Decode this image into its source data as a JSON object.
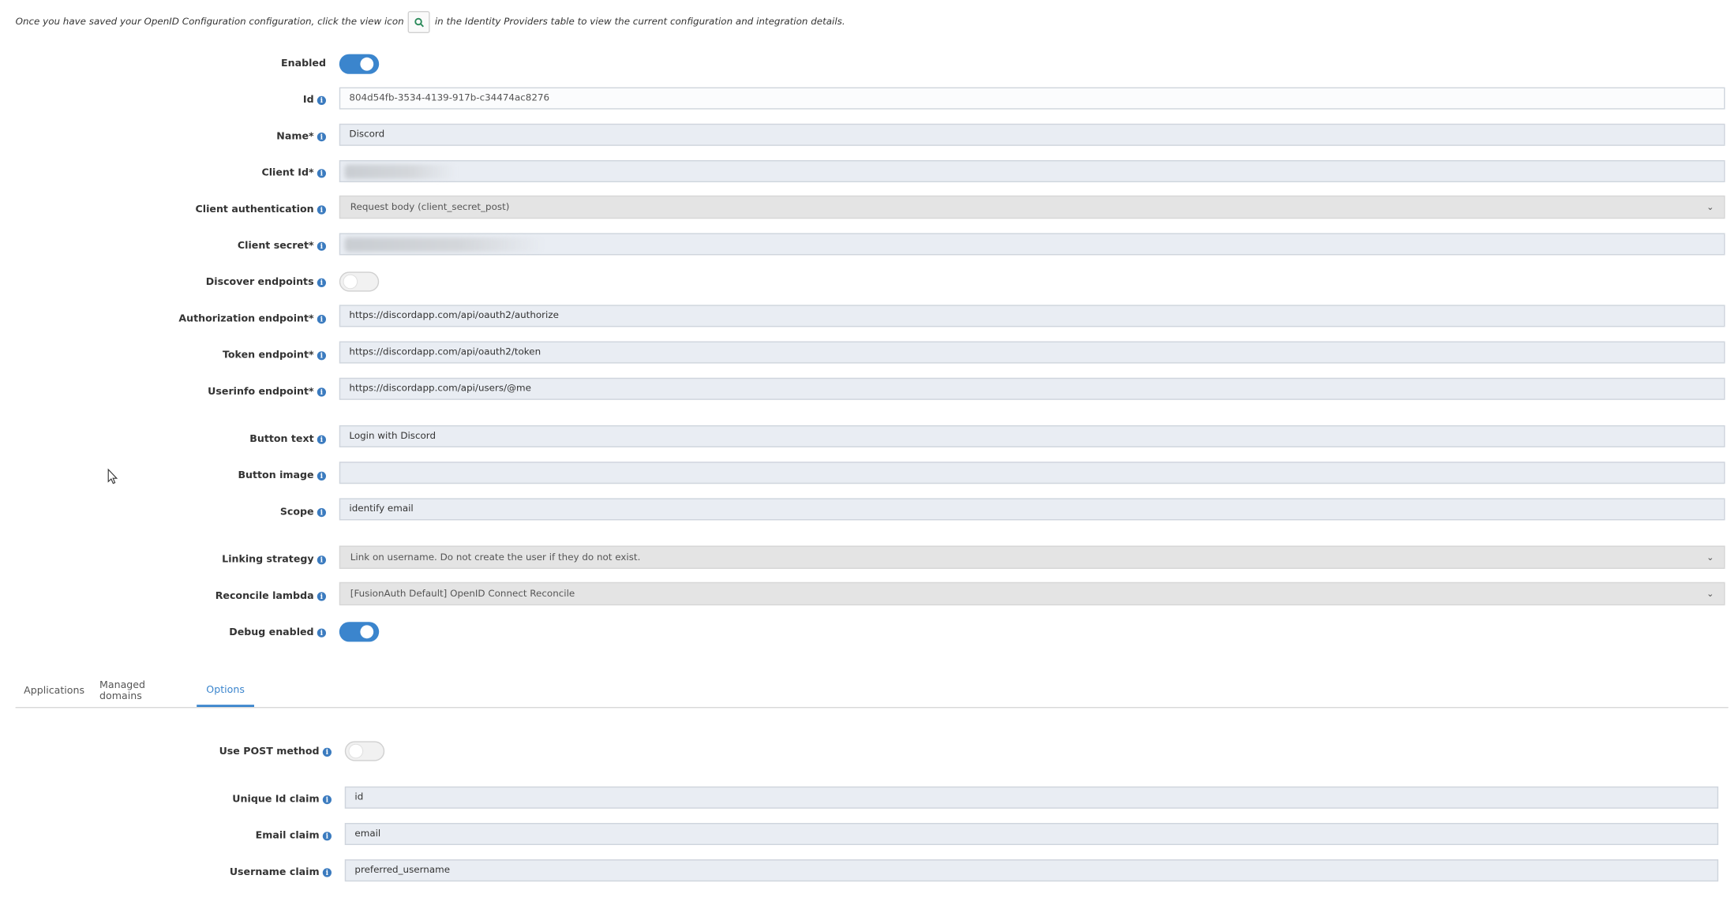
{
  "intro": {
    "text_before": "Once you have saved your OpenID Configuration configuration, click the view icon",
    "text_after": "in the Identity Providers table to view the current configuration and integration details."
  },
  "form": {
    "enabled": {
      "label": "Enabled",
      "state": "on"
    },
    "id": {
      "label": "Id",
      "value": "804d54fb-3534-4139-917b-c34474ac8276"
    },
    "name": {
      "label": "Name*",
      "value": "Discord"
    },
    "client_id": {
      "label": "Client Id*",
      "value": ""
    },
    "client_authentication": {
      "label": "Client authentication",
      "value": "Request body (client_secret_post)"
    },
    "client_secret": {
      "label": "Client secret*",
      "value": ""
    },
    "discover_endpoints": {
      "label": "Discover endpoints",
      "state": "off"
    },
    "authorization_endpoint": {
      "label": "Authorization endpoint*",
      "value": "https://discordapp.com/api/oauth2/authorize"
    },
    "token_endpoint": {
      "label": "Token endpoint*",
      "value": "https://discordapp.com/api/oauth2/token"
    },
    "userinfo_endpoint": {
      "label": "Userinfo endpoint*",
      "value": "https://discordapp.com/api/users/@me"
    },
    "button_text": {
      "label": "Button text",
      "value": "Login with Discord"
    },
    "button_image": {
      "label": "Button image",
      "value": ""
    },
    "scope": {
      "label": "Scope",
      "value": "identify email"
    },
    "linking_strategy": {
      "label": "Linking strategy",
      "value": "Link on username. Do not create the user if they do not exist."
    },
    "reconcile_lambda": {
      "label": "Reconcile lambda",
      "value": "[FusionAuth Default] OpenID Connect Reconcile"
    },
    "debug_enabled": {
      "label": "Debug enabled",
      "state": "on"
    }
  },
  "tabs": [
    {
      "label": "Applications",
      "active": false
    },
    {
      "label": "Managed domains",
      "active": false
    },
    {
      "label": "Options",
      "active": true
    }
  ],
  "options": {
    "use_post_method": {
      "label": "Use POST method",
      "state": "off"
    },
    "unique_id_claim": {
      "label": "Unique Id claim",
      "value": "id"
    },
    "email_claim": {
      "label": "Email claim",
      "value": "email"
    },
    "username_claim": {
      "label": "Username claim",
      "value": "preferred_username"
    }
  },
  "colors": {
    "accent": "#3b85cd",
    "field_bg": "#e9edf3",
    "select_bg": "#e4e4e4"
  },
  "icons": {
    "view": "search-icon",
    "info": "info-circle-icon",
    "select": "chevron-down-icon"
  }
}
